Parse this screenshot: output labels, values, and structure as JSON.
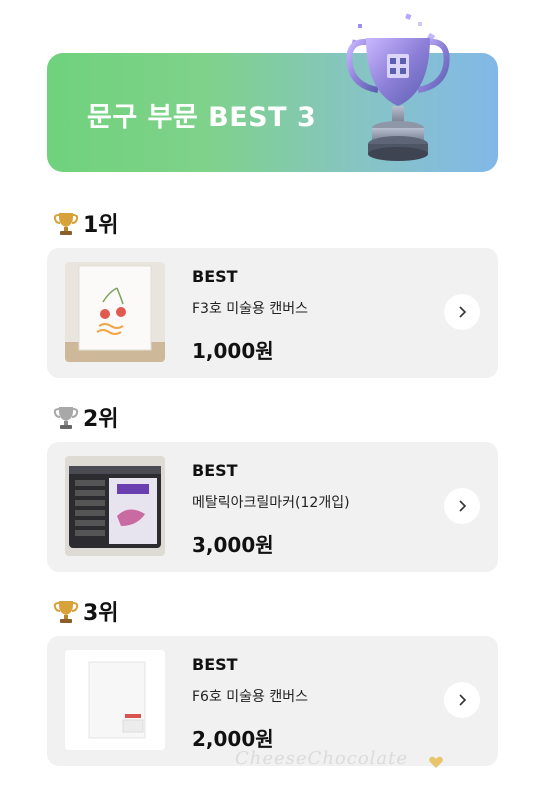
{
  "banner": {
    "title": "문구 부문 BEST 3"
  },
  "colors": {
    "gold": "#d8a23a",
    "silver": "#9a9a9a",
    "card_bg": "#f1f1f1",
    "banner_green": "#6fd27c",
    "banner_blue": "#82b8e8"
  },
  "rankings": [
    {
      "rank_label": "1위",
      "trophy": "gold-trophy-icon",
      "badge": "BEST",
      "name": "F3호 미술용 캔버스",
      "price": "1,000원"
    },
    {
      "rank_label": "2위",
      "trophy": "silver-trophy-icon",
      "badge": "BEST",
      "name": "메탈릭아크릴마커(12개입)",
      "price": "3,000원"
    },
    {
      "rank_label": "3위",
      "trophy": "gold-trophy-icon",
      "badge": "BEST",
      "name": "F6호 미술용 캔버스",
      "price": "2,000원"
    }
  ],
  "watermark": "CheeseChocolate"
}
